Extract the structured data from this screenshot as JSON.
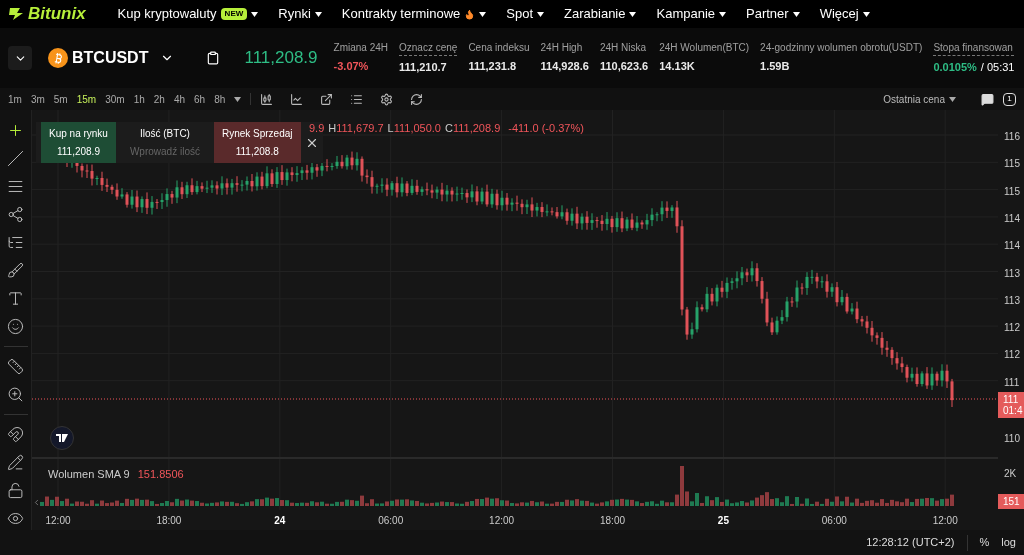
{
  "nav": {
    "logo": "Bitunix",
    "items": [
      {
        "label": "Kup kryptowaluty",
        "badge": "NEW",
        "hot": false
      },
      {
        "label": "Rynki",
        "hot": false
      },
      {
        "label": "Kontrakty terminowe",
        "hot": true
      },
      {
        "label": "Spot",
        "hot": false
      },
      {
        "label": "Zarabianie",
        "hot": false
      },
      {
        "label": "Kampanie",
        "hot": false
      },
      {
        "label": "Partner",
        "hot": false
      },
      {
        "label": "Więcej",
        "hot": false
      }
    ]
  },
  "ticker": {
    "symbol": "BTCUSDT",
    "last_price": "111,208.9",
    "stats": [
      {
        "label": "Zmiana 24H",
        "value": "-3.07%",
        "color": "#f0555a",
        "underlined": false
      },
      {
        "label": "Oznacz cenę",
        "value": "111,210.7",
        "color": "#eaeaea",
        "underlined": true
      },
      {
        "label": "Cena indeksu",
        "value": "111,231.8",
        "color": "#eaeaea",
        "underlined": false
      },
      {
        "label": "24H High",
        "value": "114,928.6",
        "color": "#eaeaea",
        "underlined": false
      },
      {
        "label": "24H Niska",
        "value": "110,623.6",
        "color": "#eaeaea",
        "underlined": false
      },
      {
        "label": "24H Wolumen(BTC)",
        "value": "14.13K",
        "color": "#eaeaea",
        "underlined": false
      },
      {
        "label": "24-godzinny wolumen obrotu(USDT)",
        "value": "1.59B",
        "color": "#eaeaea",
        "underlined": false
      },
      {
        "label": "Stopa finansowan",
        "value": "0.0105%",
        "extra": "/ 05:31",
        "color": "#2ebd85",
        "underlined": true
      }
    ]
  },
  "timeframes": [
    {
      "label": "1m",
      "selected": false
    },
    {
      "label": "3m",
      "selected": false
    },
    {
      "label": "5m",
      "selected": false
    },
    {
      "label": "15m",
      "selected": true
    },
    {
      "label": "30m",
      "selected": false
    },
    {
      "label": "1h",
      "selected": false
    },
    {
      "label": "2h",
      "selected": false
    },
    {
      "label": "4h",
      "selected": false
    },
    {
      "label": "6h",
      "selected": false
    },
    {
      "label": "8h",
      "selected": false
    }
  ],
  "price_source": "Ostatnia cena",
  "layout_button": "1",
  "trade_panel": {
    "buy": {
      "label": "Kup na rynku",
      "price": "111,208.9"
    },
    "quantity": {
      "label": "Ilość (BTC)",
      "placeholder": "Wprowadź ilość"
    },
    "sell": {
      "label": "Rynek Sprzedaj",
      "price": "111,208.8"
    }
  },
  "legend": {
    "items": [
      {
        "value": "9.9"
      },
      {
        "label": "H",
        "value": "111,679.7"
      },
      {
        "label": "L",
        "value": "111,050.0"
      },
      {
        "label": "C",
        "value": "111,208.9"
      }
    ],
    "change": "-411.0 (-0.37%)"
  },
  "price_axis": [
    "116",
    "115",
    "115",
    "114",
    "114",
    "113",
    "113",
    "112",
    "112",
    "111"
  ],
  "price_tag": [
    "111",
    "01:4"
  ],
  "lower_axis": "110",
  "volume": {
    "title": "Wolumen SMA 9",
    "value": "151.8506",
    "axis": "2K",
    "tag": "151"
  },
  "time_axis": [
    {
      "label": "12:00",
      "bold": false
    },
    {
      "label": "18:00",
      "bold": false
    },
    {
      "label": "24",
      "bold": true
    },
    {
      "label": "06:00",
      "bold": false
    },
    {
      "label": "12:00",
      "bold": false
    },
    {
      "label": "18:00",
      "bold": false
    },
    {
      "label": "25",
      "bold": true
    },
    {
      "label": "06:00",
      "bold": false
    },
    {
      "label": "12:00",
      "bold": false
    }
  ],
  "status_bar": {
    "time": "12:28:12 (UTC+2)",
    "percent": "%",
    "log": "log"
  }
}
